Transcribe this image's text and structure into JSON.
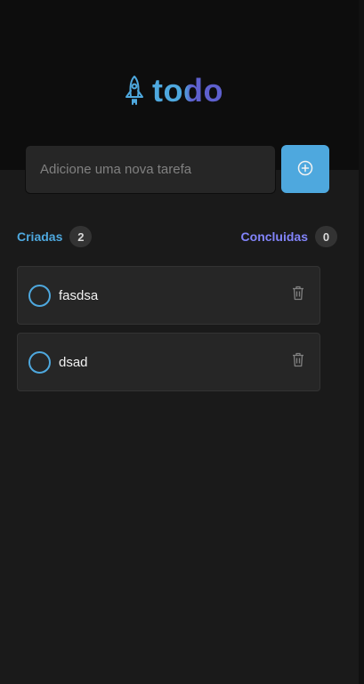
{
  "app": {
    "logo_text": "todo",
    "colors": {
      "blue": "#4ea8de",
      "purple": "#5e60ce",
      "purple_light": "#8284fa"
    }
  },
  "new_task": {
    "placeholder": "Adicione uma nova tarefa",
    "value": "",
    "add_icon": "plus-circle-icon"
  },
  "counters": {
    "created_label": "Criadas",
    "created_count": "2",
    "done_label": "Concluidas",
    "done_count": "0"
  },
  "tasks": [
    {
      "text": "fasdsa",
      "done": false
    },
    {
      "text": "dsad",
      "done": false
    }
  ]
}
